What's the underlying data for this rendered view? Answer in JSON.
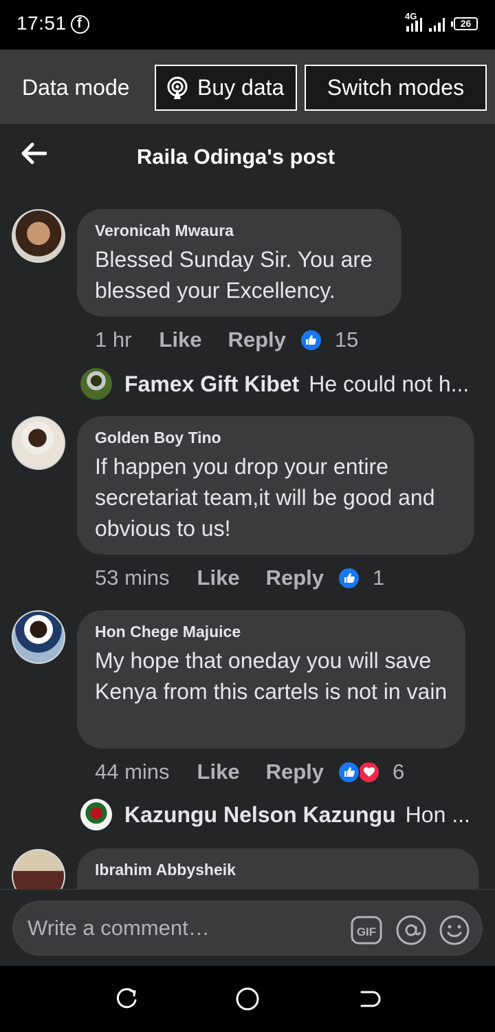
{
  "status_bar": {
    "time": "17:51",
    "network": "4G",
    "battery": "26"
  },
  "data_mode": {
    "label": "Data mode",
    "buy_label": "Buy data",
    "switch_label": "Switch modes"
  },
  "header": {
    "title": "Raila Odinga's post"
  },
  "comments": [
    {
      "author": "Veronicah Mwaura",
      "text": "Blessed Sunday Sir. You are blessed your Excellency.",
      "time": "1 hr",
      "like_label": "Like",
      "reply_label": "Reply",
      "reaction_count": "15",
      "reactions": [
        "like"
      ],
      "reply_preview": {
        "author": "Famex Gift Kibet",
        "text": "He could not h..."
      }
    },
    {
      "author": "Golden Boy Tino",
      "text": "If happen you drop your entire secretariat team,it will be good and obvious to us!",
      "time": "53 mins",
      "like_label": "Like",
      "reply_label": "Reply",
      "reaction_count": "1",
      "reactions": [
        "like"
      ]
    },
    {
      "author": "Hon Chege Majuice",
      "text": "My hope that oneday you will save Kenya from this cartels is not in vain",
      "time": "44 mins",
      "like_label": "Like",
      "reply_label": "Reply",
      "reaction_count": "6",
      "reactions": [
        "like",
        "love"
      ],
      "reply_preview": {
        "author": "Kazungu Nelson Kazungu",
        "text": "Hon ..."
      }
    },
    {
      "author": "Ibrahim Abbysheik"
    }
  ],
  "composer": {
    "placeholder": "Write a comment…",
    "gif_label": "GIF"
  },
  "colors": {
    "like_blue": "#1877f2",
    "love_red": "#f02849",
    "bg": "#242526",
    "bubble": "#3a3b3c"
  }
}
